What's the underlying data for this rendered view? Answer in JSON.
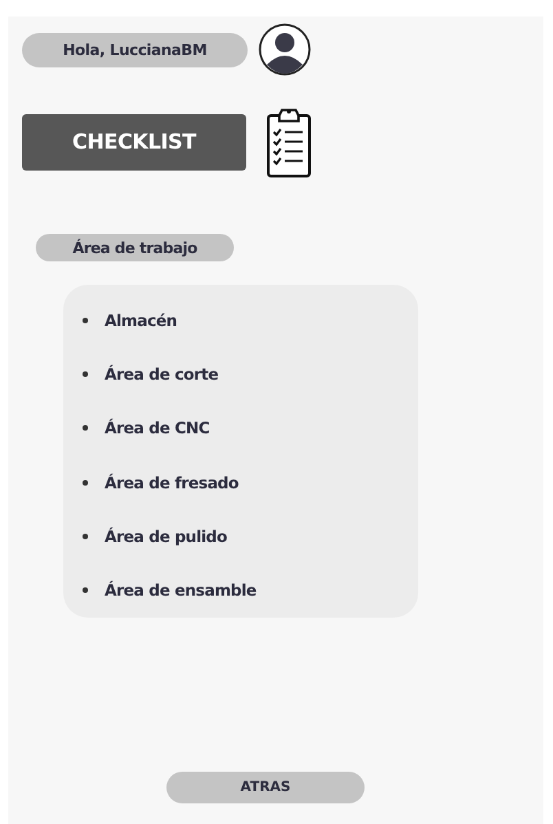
{
  "greeting": "Hola, LuccianaBM",
  "checklist_button": "CHECKLIST",
  "section_label": "Área de trabajo",
  "work_areas": [
    {
      "label": "Almacén"
    },
    {
      "label": "Área de corte"
    },
    {
      "label": "Área de CNC"
    },
    {
      "label": "Área de fresado"
    },
    {
      "label": "Área de pulido"
    },
    {
      "label": "Área de ensamble"
    }
  ],
  "back_button": "ATRAS"
}
